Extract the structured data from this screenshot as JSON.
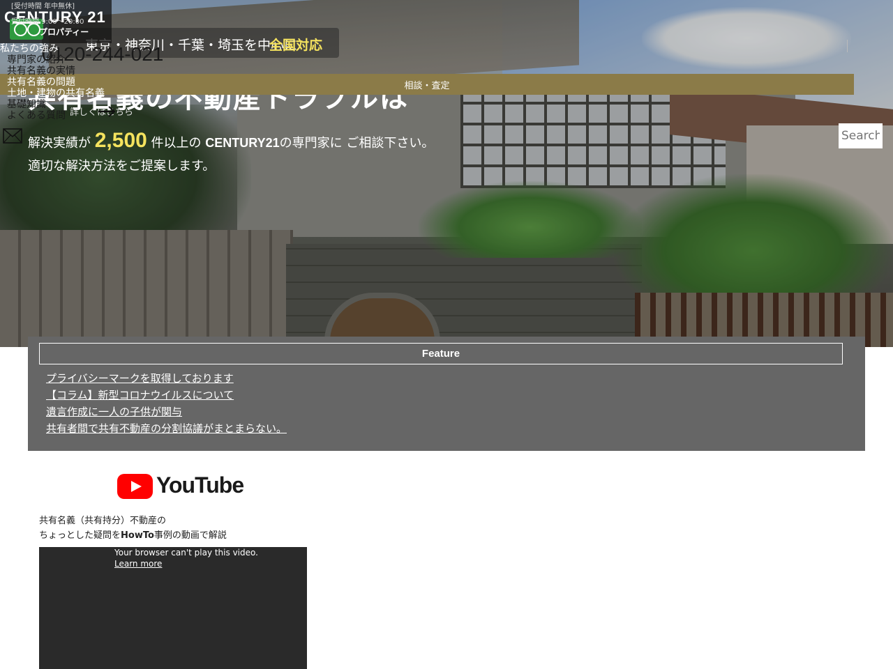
{
  "header": {
    "brand": "CENTURY 21",
    "brand_sub": "プロパティー",
    "hours_line1": "[受付時間 年中無休]",
    "hours_line2": "受付時間 9:00〜20:00",
    "area_text": "東京・神奈川・千葉・埼玉を中心に",
    "area_highlight": "全国対応",
    "phone": "0120-244-021"
  },
  "nav": {
    "items": [
      "私たちの強み",
      "専門家の紹介",
      "共有名義の実情",
      "共有名義の問題",
      "土地・建物の共有名義",
      "基礎知識",
      "よくある質問"
    ]
  },
  "consult": {
    "label": "相談・査定"
  },
  "hero": {
    "headline": "共有名義の不動産トラブルは",
    "sub_prefix": "解決実績が",
    "sub_number": "2,500",
    "sub_middle": "件以上の",
    "sub_brand": "CENTURY21",
    "sub_suffix": "の専門家に ご相談下さい。",
    "sub_line2": "適切な解決方法をご提案します。",
    "more_label": "詳しくはこちら"
  },
  "search": {
    "placeholder": "Search"
  },
  "feature": {
    "title": "Feature",
    "links": [
      "プライバシーマークを取得しております",
      "【コラム】新型コロナウイルスについて",
      "遺言作成に一人の子供が関与",
      "共有者間で共有不動産の分割協議がまとまらない。"
    ]
  },
  "youtube": {
    "logo_text": "YouTube",
    "caption_line1": "共有名義（共有持分）不動産の",
    "caption_line2_a": "ちょっとした疑問を",
    "caption_line2_b": "HowTo",
    "caption_line2_c": "事例の動画で解説",
    "video_message": "Your browser can't play this video.",
    "video_link": "Learn more"
  },
  "colors": {
    "consult_bar": "#8b7b48",
    "highlight": "#f5e35e",
    "feature_bg": "#666666",
    "logo_green": "#2e9a3f",
    "youtube_red": "#ff0000"
  }
}
